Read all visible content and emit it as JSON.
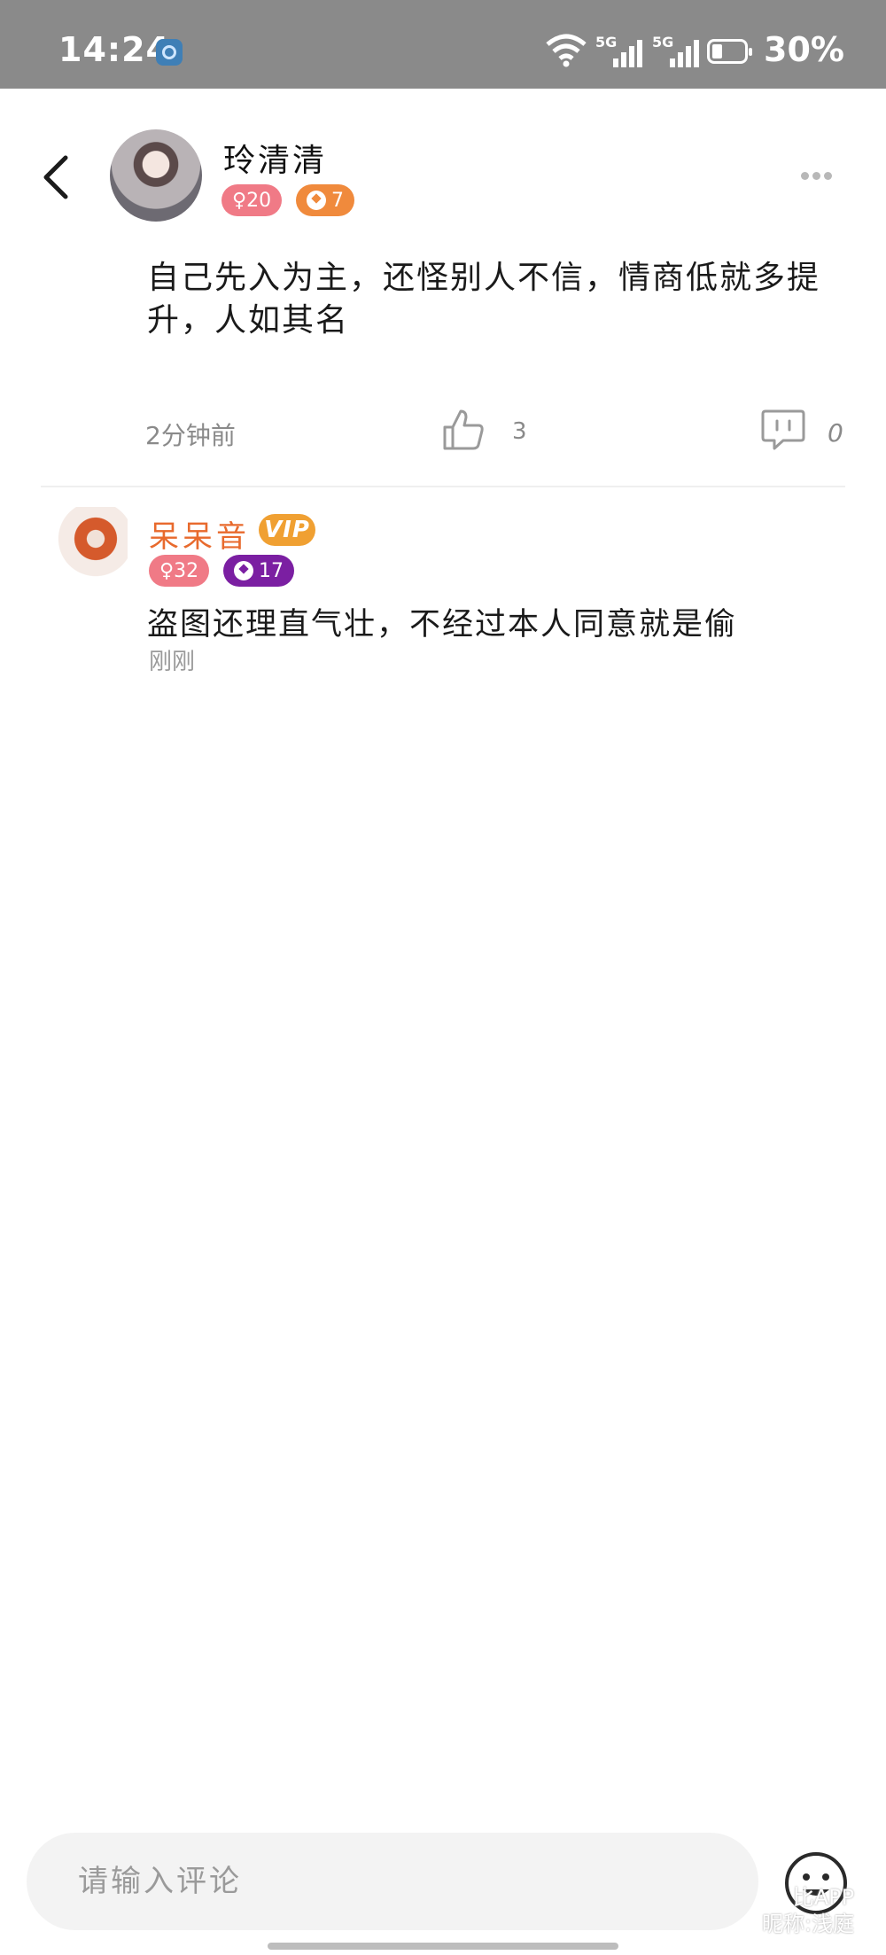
{
  "status_bar": {
    "time": "14:24",
    "network_a": "5G",
    "network_b": "5G",
    "battery": "30%"
  },
  "post": {
    "author": "玲清清",
    "gender_badge": "♀20",
    "level_badge": "7",
    "content": "自己先入为主，还怪别人不信，情商低就多提升，人如其名",
    "time": "2分钟前",
    "likes": "3",
    "comments": "0"
  },
  "reply": {
    "author": "呆呆音",
    "vip_label": "VIP",
    "gender_badge": "♀32",
    "level_badge": "17",
    "content": "盗图还理直气壮，不经过本人同意就是偷",
    "time": "刚刚"
  },
  "input": {
    "placeholder": "请输入评论"
  },
  "watermark": {
    "line1": "比APP",
    "line2": "昵称:浅庭"
  },
  "colors": {
    "gender_badge": "#f07a86",
    "level_badge_orange": "#f08a3c",
    "level_badge_purple": "#7b1fa2",
    "vip": "#f0a032",
    "reply_name": "#e86a2d"
  },
  "icons": [
    "back-icon",
    "more-icon",
    "like-icon",
    "comment-icon",
    "emoji-icon",
    "wifi-icon",
    "signal-icon",
    "battery-icon"
  ]
}
